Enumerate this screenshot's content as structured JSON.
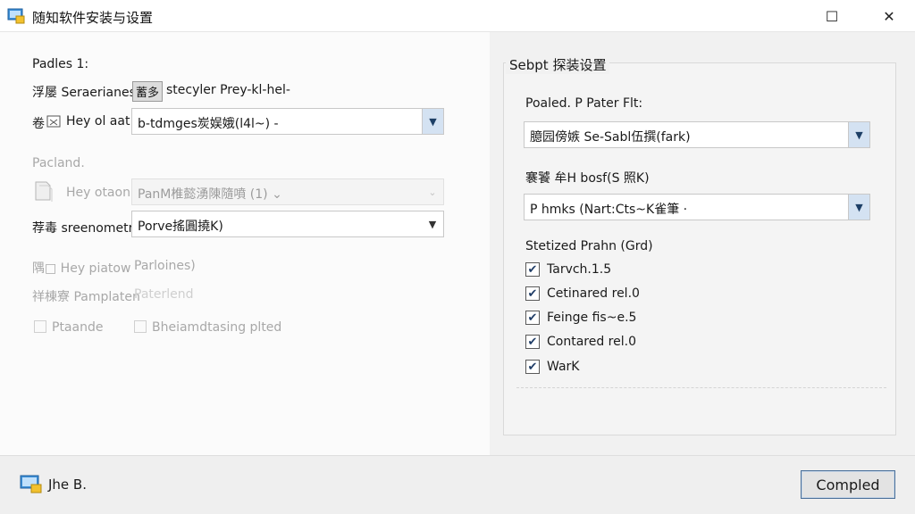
{
  "window": {
    "title": "随知软件安装与设置",
    "maximize_glyph": "☐",
    "close_glyph": "✕"
  },
  "left": {
    "section1_label": "Padles 1:",
    "row1": {
      "label": "浮屡 Seraerianes",
      "chip": "蓄多",
      "value": "stecyler Prey-kl-hel-"
    },
    "row2": {
      "prefix": "卷",
      "label": "Hey ol aat:",
      "value": "b-tdmges炭娱娥(l4l~) -",
      "arrow": "▼"
    },
    "section2_label": "Pacland.",
    "row3": {
      "label": "Hey otaon",
      "value": "PanM椎懿湧陳隨噴 (1) ⌄",
      "arrow": "⌄"
    },
    "row4": {
      "label": "荐毒 sreenometr",
      "value": "Porve搖圓撓K)",
      "arrow": "▼"
    },
    "row5": {
      "label": "隅□ Hey piatow",
      "value": "Parloines)"
    },
    "row6": {
      "label": "祥棟寮 Pamplaten",
      "value": "Paterlend"
    },
    "check1": {
      "label": "Ptaande",
      "checked": false
    },
    "check2": {
      "label": "Bheiamdtasing plted",
      "checked": false
    }
  },
  "right": {
    "group_title": "Sebpt 探装设置",
    "field1": {
      "label": "Poaled. P Pater Flt:",
      "value": "臆园傍嫉 Se-Sabl伍撰(fark)",
      "arrow": "▼"
    },
    "field2": {
      "label": "褰饕 牟H bosf(S 照K)",
      "value": "P hmks (Nart:Cts~K雀筆 ·",
      "arrow": "▼"
    },
    "list_label": "Stetized Prahn (Grd)",
    "items": [
      {
        "label": "Tarvch.1.5",
        "checked": true
      },
      {
        "label": "Cetinared rel.0",
        "checked": true
      },
      {
        "label": "Feinge fis~e.5",
        "checked": true
      },
      {
        "label": "Contared rel.0",
        "checked": true
      },
      {
        "label": "WarK",
        "checked": true
      }
    ],
    "check_glyph": "✔"
  },
  "footer": {
    "text": "Jhe B.",
    "button_label": "Compled"
  },
  "colors": {
    "accent": "#4a6f98",
    "dropdown_bg": "#d4e2f2",
    "app_icon": "#3c8fd6"
  }
}
